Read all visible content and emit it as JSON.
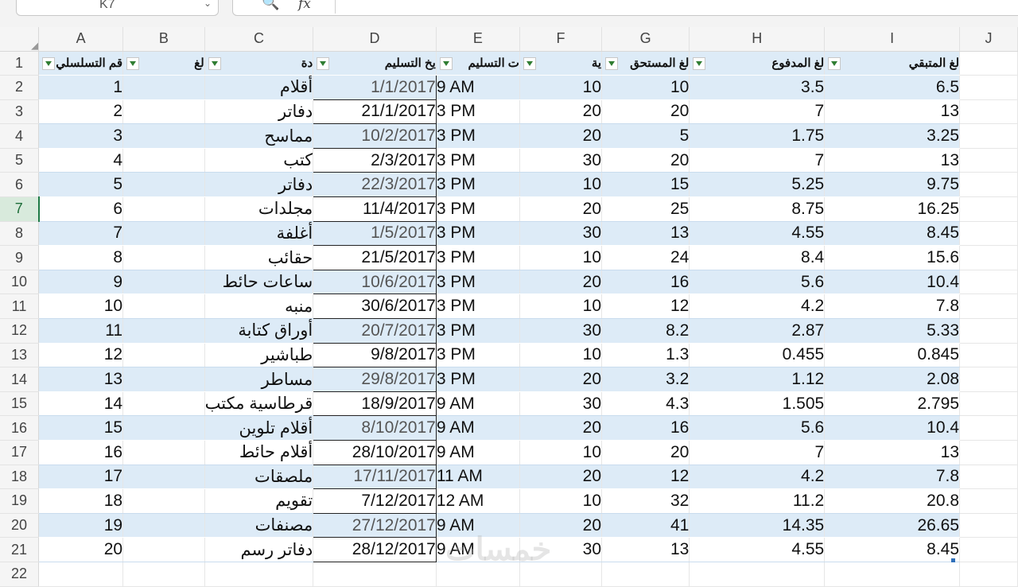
{
  "toolbar": {
    "name_box_value": "K7",
    "name_box_arrow": "⌄",
    "zoom_glyph": "🔍",
    "fx_label": "fx"
  },
  "columns": [
    "A",
    "B",
    "C",
    "D",
    "E",
    "F",
    "G",
    "H",
    "I",
    "J"
  ],
  "row_numbers": [
    "1",
    "2",
    "3",
    "4",
    "5",
    "6",
    "7",
    "8",
    "9",
    "10",
    "11",
    "12",
    "13",
    "14",
    "15",
    "16",
    "17",
    "18",
    "19",
    "20",
    "21",
    "22"
  ],
  "headers": {
    "A": "قم التسلسلي",
    "B": "لغ",
    "C": "دة",
    "D": "يخ التسليم",
    "E": "ت التسليم",
    "F": "ية",
    "G": "لغ المستحق",
    "H": "لغ المدفوع",
    "I": "لغ المتبقي"
  },
  "rows": [
    {
      "a": "1",
      "c": "أقلام",
      "d": "1/1/2017",
      "e": "9 AM",
      "f": "10",
      "g": "10",
      "h": "3.5",
      "i": "6.5"
    },
    {
      "a": "2",
      "c": "دفاتر",
      "d": "21/1/2017",
      "e": "3 PM",
      "f": "20",
      "g": "20",
      "h": "7",
      "i": "13"
    },
    {
      "a": "3",
      "c": "مماسح",
      "d": "10/2/2017",
      "e": "3 PM",
      "f": "20",
      "g": "5",
      "h": "1.75",
      "i": "3.25"
    },
    {
      "a": "4",
      "c": "كتب",
      "d": "2/3/2017",
      "e": "3 PM",
      "f": "30",
      "g": "20",
      "h": "7",
      "i": "13"
    },
    {
      "a": "5",
      "c": "دفاتر",
      "d": "22/3/2017",
      "e": "3 PM",
      "f": "10",
      "g": "15",
      "h": "5.25",
      "i": "9.75"
    },
    {
      "a": "6",
      "c": "مجلدات",
      "d": "11/4/2017",
      "e": "3 PM",
      "f": "20",
      "g": "25",
      "h": "8.75",
      "i": "16.25"
    },
    {
      "a": "7",
      "c": "أغلفة",
      "d": "1/5/2017",
      "e": "3 PM",
      "f": "30",
      "g": "13",
      "h": "4.55",
      "i": "8.45"
    },
    {
      "a": "8",
      "c": "حقائب",
      "d": "21/5/2017",
      "e": "3 PM",
      "f": "10",
      "g": "24",
      "h": "8.4",
      "i": "15.6"
    },
    {
      "a": "9",
      "c": "ساعات حائط",
      "d": "10/6/2017",
      "e": "3 PM",
      "f": "20",
      "g": "16",
      "h": "5.6",
      "i": "10.4"
    },
    {
      "a": "10",
      "c": "منبه",
      "d": "30/6/2017",
      "e": "3 PM",
      "f": "10",
      "g": "12",
      "h": "4.2",
      "i": "7.8"
    },
    {
      "a": "11",
      "c": "أوراق كتابة",
      "d": "20/7/2017",
      "e": "3 PM",
      "f": "30",
      "g": "8.2",
      "h": "2.87",
      "i": "5.33"
    },
    {
      "a": "12",
      "c": "طباشير",
      "d": "9/8/2017",
      "e": "3 PM",
      "f": "10",
      "g": "1.3",
      "h": "0.455",
      "i": "0.845"
    },
    {
      "a": "13",
      "c": "مساطر",
      "d": "29/8/2017",
      "e": "3 PM",
      "f": "20",
      "g": "3.2",
      "h": "1.12",
      "i": "2.08"
    },
    {
      "a": "14",
      "c": "قرطاسية مكتب",
      "d": "18/9/2017",
      "e": "9 AM",
      "f": "30",
      "g": "4.3",
      "h": "1.505",
      "i": "2.795"
    },
    {
      "a": "15",
      "c": "أقلام تلوين",
      "d": "8/10/2017",
      "e": "9 AM",
      "f": "20",
      "g": "16",
      "h": "5.6",
      "i": "10.4"
    },
    {
      "a": "16",
      "c": "أقلام حائط",
      "d": "28/10/2017",
      "e": "9 AM",
      "f": "10",
      "g": "20",
      "h": "7",
      "i": "13"
    },
    {
      "a": "17",
      "c": "ملصقات",
      "d": "17/11/2017",
      "e": "11 AM",
      "f": "20",
      "g": "12",
      "h": "4.2",
      "i": "7.8"
    },
    {
      "a": "18",
      "c": "تقويم",
      "d": "7/12/2017",
      "e": "12 AM",
      "f": "10",
      "g": "32",
      "h": "11.2",
      "i": "20.8"
    },
    {
      "a": "19",
      "c": "مصنفات",
      "d": "27/12/2017",
      "e": "9 AM",
      "f": "20",
      "g": "41",
      "h": "14.35",
      "i": "26.65"
    },
    {
      "a": "20",
      "c": "دفاتر رسم",
      "d": "28/12/2017",
      "e": "9 AM",
      "f": "30",
      "g": "13",
      "h": "4.55",
      "i": "8.45"
    }
  ],
  "watermark": "خمسات",
  "colors": {
    "band": "#ddebf7",
    "header_bg": "#f5f5f5",
    "filter_arrow": "#2f7d32",
    "selected_row": "#1e7a45"
  }
}
